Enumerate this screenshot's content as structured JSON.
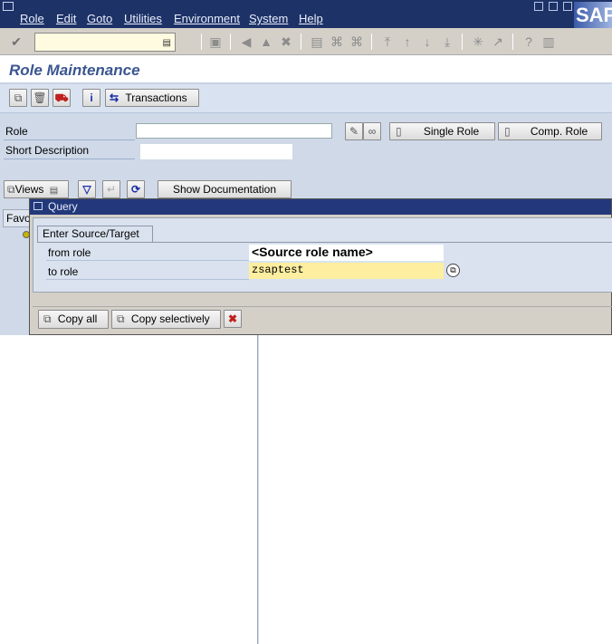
{
  "menubar": {
    "items": [
      "Role",
      "Edit",
      "Goto",
      "Utilities",
      "Environment",
      "System",
      "Help"
    ],
    "logo": "SAP"
  },
  "std_toolbar": {
    "command_field_value": "",
    "icons": [
      "enter-icon",
      "save-icon",
      "back-icon",
      "exit-icon",
      "cancel-icon",
      "print-icon",
      "find-icon",
      "find-next-icon",
      "first-page-icon",
      "previous-page-icon",
      "next-page-icon",
      "last-page-icon",
      "new-session-icon",
      "shortcut-icon",
      "help-icon",
      "customize-layout-icon"
    ]
  },
  "title": "Role Maintenance",
  "app_toolbar": {
    "transactions_label": "Transactions"
  },
  "form": {
    "role_label": "Role",
    "role_value": "",
    "short_desc_label": "Short Description",
    "short_desc_value": "",
    "single_role_label": "Single Role",
    "comp_role_label": "Comp. Role"
  },
  "views_toolbar": {
    "views_label": "Views",
    "show_documentation_label": "Show Documentation"
  },
  "tree": {
    "favorites_label": "Favo"
  },
  "dialog": {
    "title": "Query",
    "tab_label": "Enter Source/Target",
    "from_role_label": "from role",
    "from_role_value": "<Source role name>",
    "to_role_label": "to role",
    "to_role_value": "zsaptest",
    "copy_all_label": "Copy all",
    "copy_selectively_label": "Copy selectively"
  },
  "colors": {
    "menubar": "#1d3266",
    "title_text": "#3b5691",
    "content_bg": "#cfd9e8",
    "required_field": "#fdeea0"
  }
}
